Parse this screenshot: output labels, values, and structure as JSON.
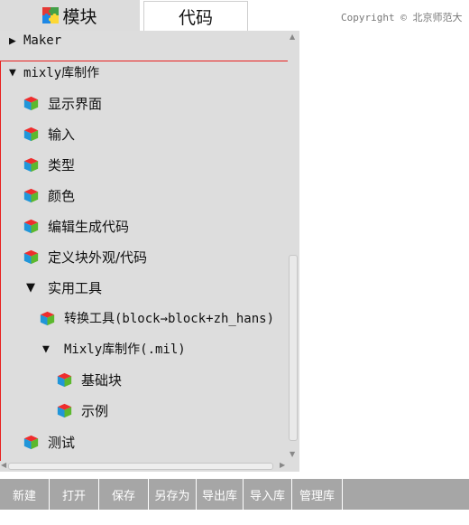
{
  "tabs": {
    "blocks_label": "模块",
    "code_label": "代码"
  },
  "copyright": "Copyright © 北京师范大",
  "toolbox": {
    "categories": [
      {
        "label": "Maker",
        "expanded": false
      },
      {
        "label": "mixly库制作",
        "expanded": true
      },
      {
        "label": "显示界面"
      },
      {
        "label": "输入"
      },
      {
        "label": "类型"
      },
      {
        "label": "颜色"
      },
      {
        "label": "编辑生成代码"
      },
      {
        "label": "定义块外观/代码"
      },
      {
        "label": "实用工具",
        "expanded": true
      },
      {
        "label": "转换工具(block→block+zh_hans)"
      },
      {
        "label": "Mixly库制作(.mil)",
        "expanded": true
      },
      {
        "label": "基础块"
      },
      {
        "label": "示例"
      },
      {
        "label": "测试"
      }
    ]
  },
  "bottom_toolbar": {
    "new": "新建",
    "open": "打开",
    "save": "保存",
    "save_as": "另存为",
    "export_lib": "导出库",
    "import_lib": "导入库",
    "manage_lib": "管理库"
  },
  "colors": {
    "selection_border": "#e8201f",
    "toolbar_bg": "#a6a6a6",
    "panel_bg": "#dddddd"
  }
}
